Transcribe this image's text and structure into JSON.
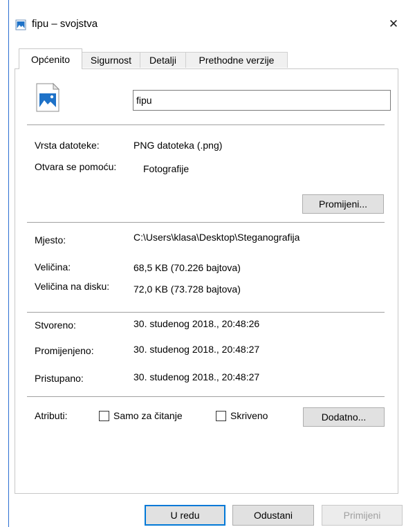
{
  "window": {
    "title": "fipu – svojstva",
    "close_glyph": "✕"
  },
  "tabs": [
    {
      "label": "Općenito",
      "active": true
    },
    {
      "label": "Sigurnost",
      "active": false
    },
    {
      "label": "Detalji",
      "active": false
    },
    {
      "label": "Prethodne verzije",
      "active": false
    }
  ],
  "general": {
    "file_name": "fipu",
    "file_type_label": "Vrsta datoteke:",
    "file_type_value": "PNG datoteka (.png)",
    "opens_with_label": "Otvara se pomoću:",
    "opens_with_value": "Fotografije",
    "change_button": "Promijeni...",
    "location_label": "Mjesto:",
    "location_value": "C:\\Users\\klasa\\Desktop\\Steganografija",
    "size_label": "Veličina:",
    "size_value": "68,5 KB (70.226 bajtova)",
    "size_on_disk_label": "Veličina na disku:",
    "size_on_disk_value": "72,0 KB (73.728 bajtova)",
    "created_label": "Stvoreno:",
    "created_value": "30. studenog 2018., 20:48:26",
    "modified_label": "Promijenjeno:",
    "modified_value": "30. studenog 2018., 20:48:27",
    "accessed_label": "Pristupano:",
    "accessed_value": "30. studenog 2018., 20:48:27",
    "attributes_label": "Atributi:",
    "readonly_label": "Samo za čitanje",
    "readonly_checked": false,
    "hidden_label": "Skriveno",
    "hidden_checked": false,
    "advanced_button": "Dodatno..."
  },
  "footer": {
    "ok": "U redu",
    "cancel": "Odustani",
    "apply": "Primijeni"
  },
  "colors": {
    "accent": "#0078d7",
    "icon_blue": "#1e72c8"
  },
  "icons": {
    "title_icon": "image-file-icon",
    "file_icon": "image-file-icon"
  }
}
